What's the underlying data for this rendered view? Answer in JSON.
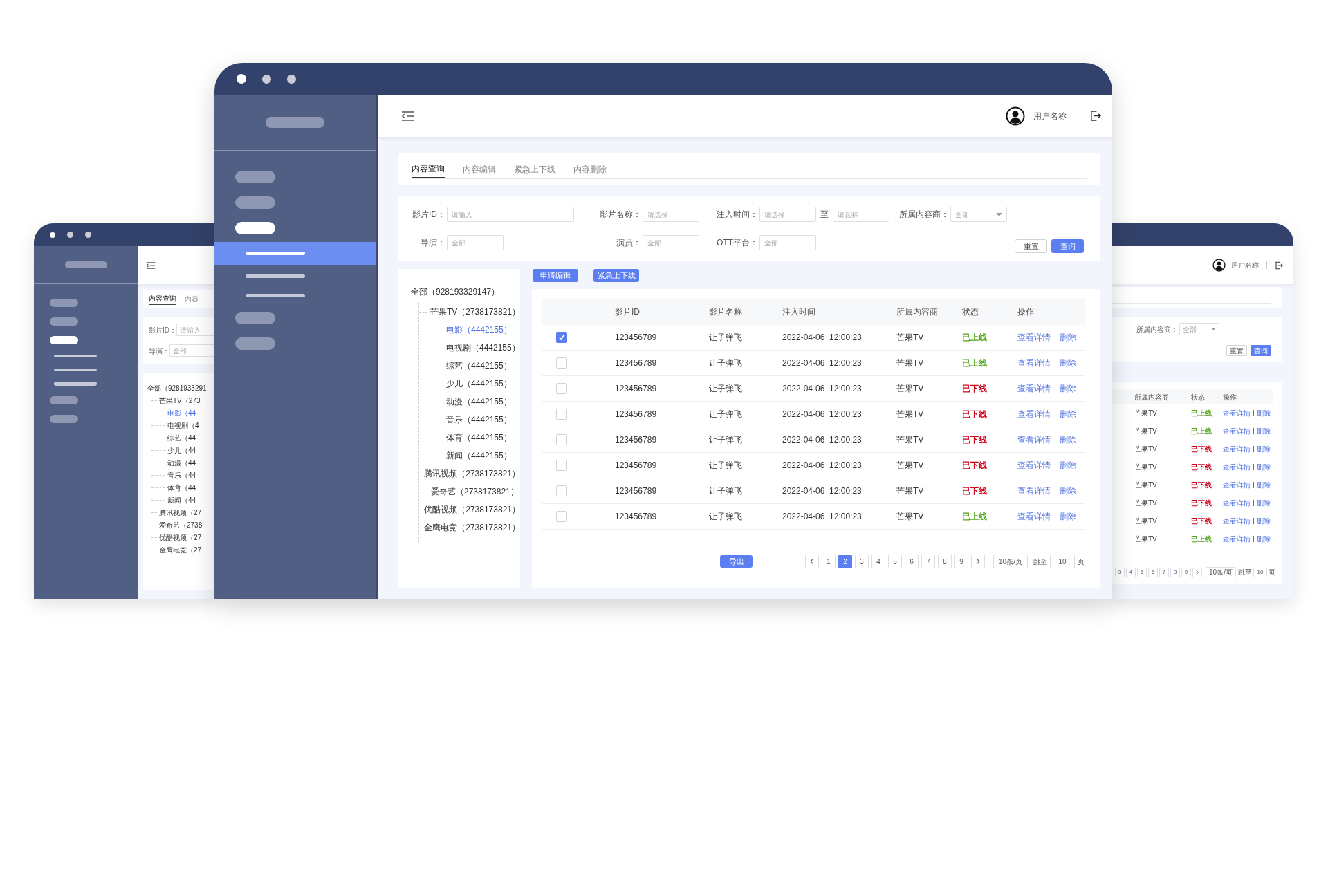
{
  "main_window": {
    "sidebar": {
      "items": [
        {
          "selected": false
        },
        {
          "selected": false
        },
        {
          "selected": true,
          "children": [
            {
              "selected": true
            },
            {
              "selected": false
            },
            {
              "selected": false
            }
          ]
        },
        {
          "selected": false
        },
        {
          "selected": false
        }
      ]
    },
    "user_name": "用户名称",
    "tabs": [
      {
        "label": "内容查询",
        "selected": true
      },
      {
        "label": "内容编辑",
        "selected": false
      },
      {
        "label": "紧急上下线",
        "selected": false
      },
      {
        "label": "内容删除",
        "selected": false
      }
    ],
    "filter_rows": [
      [
        {
          "kind": "input",
          "label": "影片ID：",
          "placeholder": "请输入"
        },
        {
          "kind": "input",
          "label": "影片名称：",
          "placeholder": "请选择"
        },
        {
          "kind": "range",
          "label": "注入时间：",
          "placeholder": "请选择",
          "separator": "至",
          "end_placeholder": "请选择"
        },
        {
          "kind": "select",
          "label": "所属内容商：",
          "placeholder": "全部"
        }
      ],
      [
        {
          "kind": "input",
          "label": "导演：",
          "placeholder": "全部"
        },
        {
          "kind": "input",
          "label": "演员：",
          "placeholder": "全部"
        },
        {
          "kind": "input",
          "label": "OTT平台：",
          "placeholder": "全部"
        }
      ]
    ],
    "filter_buttons": [
      {
        "label": "重置",
        "kind": "default"
      },
      {
        "label": "查询",
        "kind": "primary"
      }
    ],
    "tree": {
      "label": "全部（928193329147）",
      "selected": false,
      "children": [
        {
          "label": "芒果TV（2738173821）",
          "selected": false,
          "children": [
            {
              "label": "电影（4442155）",
              "selected": true
            },
            {
              "label": "电视剧（4442155）",
              "selected": false
            },
            {
              "label": "综艺（4442155）",
              "selected": false
            },
            {
              "label": "少儿（4442155）",
              "selected": false
            },
            {
              "label": "动漫（4442155）",
              "selected": false
            },
            {
              "label": "音乐（4442155）",
              "selected": false
            },
            {
              "label": "体育（4442155）",
              "selected": false
            },
            {
              "label": "新闻（4442155）",
              "selected": false
            }
          ]
        },
        {
          "label": "腾讯视频（2738173821）",
          "selected": false
        },
        {
          "label": "爱奇艺（2738173821）",
          "selected": false
        },
        {
          "label": "优酷视频（2738173821）",
          "selected": false
        },
        {
          "label": "金鹰电竞（2738173821）",
          "selected": false
        }
      ]
    },
    "toolbar_buttons": [
      "申请编辑",
      "紧急上下线"
    ],
    "table": {
      "columns": [
        "影片ID",
        "影片名称",
        "注入时间",
        "所属内容商",
        "状态",
        "操作"
      ],
      "rows": [
        {
          "checked": true,
          "id": "123456789",
          "name": "让子弹飞",
          "time": "2022-04-06  12:00:23",
          "provider": "芒果TV",
          "status": "已上线",
          "color": "#52a71a",
          "actions": [
            "查看详情",
            "删除"
          ]
        },
        {
          "checked": false,
          "id": "123456789",
          "name": "让子弹飞",
          "time": "2022-04-06  12:00:23",
          "provider": "芒果TV",
          "status": "已上线",
          "color": "#52a71a",
          "actions": [
            "查看详情",
            "删除"
          ]
        },
        {
          "checked": false,
          "id": "123456789",
          "name": "让子弹飞",
          "time": "2022-04-06  12:00:23",
          "provider": "芒果TV",
          "status": "已下线",
          "color": "#d0021b",
          "actions": [
            "查看详情",
            "删除"
          ]
        },
        {
          "checked": false,
          "id": "123456789",
          "name": "让子弹飞",
          "time": "2022-04-06  12:00:23",
          "provider": "芒果TV",
          "status": "已下线",
          "color": "#d0021b",
          "actions": [
            "查看详情",
            "删除"
          ]
        },
        {
          "checked": false,
          "id": "123456789",
          "name": "让子弹飞",
          "time": "2022-04-06  12:00:23",
          "provider": "芒果TV",
          "status": "已下线",
          "color": "#d0021b",
          "actions": [
            "查看详情",
            "删除"
          ]
        },
        {
          "checked": false,
          "id": "123456789",
          "name": "让子弹飞",
          "time": "2022-04-06  12:00:23",
          "provider": "芒果TV",
          "status": "已下线",
          "color": "#d0021b",
          "actions": [
            "查看详情",
            "删除"
          ]
        },
        {
          "checked": false,
          "id": "123456789",
          "name": "让子弹飞",
          "time": "2022-04-06  12:00:23",
          "provider": "芒果TV",
          "status": "已下线",
          "color": "#d0021b",
          "actions": [
            "查看详情",
            "删除"
          ]
        },
        {
          "checked": false,
          "id": "123456789",
          "name": "让子弹飞",
          "time": "2022-04-06  12:00:23",
          "provider": "芒果TV",
          "status": "已上线",
          "color": "#52a71a",
          "actions": [
            "查看详情",
            "删除"
          ]
        }
      ]
    },
    "export_button": "导出",
    "pagination": {
      "pages": [
        {
          "label": "1",
          "selected": false
        },
        {
          "label": "2",
          "selected": true
        },
        {
          "label": "3",
          "selected": false
        },
        {
          "label": "4",
          "selected": false
        },
        {
          "label": "5",
          "selected": false
        },
        {
          "label": "6",
          "selected": false
        },
        {
          "label": "7",
          "selected": false
        },
        {
          "label": "8",
          "selected": false
        },
        {
          "label": "9",
          "selected": false
        }
      ],
      "page_size": "10条/页",
      "jump_label": "跳至",
      "jump_value": "10",
      "page_unit": "页"
    }
  },
  "left_window": {
    "sidebar": {
      "items": [
        {
          "selected": false
        },
        {
          "selected": false
        },
        {
          "selected": true,
          "children": [
            {
              "selected": false
            },
            {
              "selected": false
            },
            {
              "selected": true
            }
          ]
        },
        {
          "selected": false
        },
        {
          "selected": false
        }
      ]
    },
    "tabs": [
      {
        "label": "内容查询",
        "selected": true
      },
      {
        "label": "内容",
        "selected": false
      }
    ],
    "filter_rows": [
      [
        {
          "kind": "input",
          "label": "影片ID：",
          "placeholder": "请输入"
        }
      ],
      [
        {
          "kind": "input",
          "label": "导演：",
          "placeholder": "全部"
        }
      ]
    ],
    "tree": {
      "label": "全部（9281933291",
      "selected": false,
      "children": [
        {
          "label": "芒果TV（273",
          "selected": false,
          "children": [
            {
              "label": "电影（44",
              "selected": true
            },
            {
              "label": "电视剧（4",
              "selected": false
            },
            {
              "label": "综艺（44",
              "selected": false
            },
            {
              "label": "少儿（44",
              "selected": false
            },
            {
              "label": "动漫（44",
              "selected": false
            },
            {
              "label": "音乐（44",
              "selected": false
            },
            {
              "label": "体育（44",
              "selected": false
            },
            {
              "label": "新闻（44",
              "selected": false
            }
          ]
        },
        {
          "label": "腾讯视频（27",
          "selected": false
        },
        {
          "label": "爱奇艺（2738",
          "selected": false
        },
        {
          "label": "优酷视频（27",
          "selected": false
        },
        {
          "label": "金鹰电竞（27",
          "selected": false
        }
      ]
    }
  },
  "right_window": {
    "user_name": "用户名称",
    "filter": {
      "label": "所属内容商：",
      "placeholder": "全部"
    },
    "filter_buttons": [
      {
        "label": "重置",
        "kind": "default"
      },
      {
        "label": "查询",
        "kind": "primary"
      }
    ],
    "table": {
      "columns": [
        "所属内容商",
        "状态",
        "操作"
      ],
      "rows": [
        {
          "provider": "芒果TV",
          "status": "已上线",
          "color": "#52a71a",
          "actions": [
            "查看详情",
            "删除"
          ]
        },
        {
          "provider": "芒果TV",
          "status": "已上线",
          "color": "#52a71a",
          "actions": [
            "查看详情",
            "删除"
          ]
        },
        {
          "provider": "芒果TV",
          "status": "已下线",
          "color": "#d0021b",
          "actions": [
            "查看详情",
            "删除"
          ]
        },
        {
          "provider": "芒果TV",
          "status": "已下线",
          "color": "#d0021b",
          "actions": [
            "查看详情",
            "删除"
          ]
        },
        {
          "provider": "芒果TV",
          "status": "已下线",
          "color": "#d0021b",
          "actions": [
            "查看详情",
            "删除"
          ]
        },
        {
          "provider": "芒果TV",
          "status": "已下线",
          "color": "#d0021b",
          "actions": [
            "查看详情",
            "删除"
          ]
        },
        {
          "provider": "芒果TV",
          "status": "已下线",
          "color": "#d0021b",
          "actions": [
            "查看详情",
            "删除"
          ]
        },
        {
          "provider": "芒果TV",
          "status": "已上线",
          "color": "#52a71a",
          "actions": [
            "查看详情",
            "删除"
          ]
        }
      ]
    },
    "pagination": {
      "pages": [
        {
          "label": "3",
          "selected": false
        },
        {
          "label": "4",
          "selected": false
        },
        {
          "label": "5",
          "selected": false
        },
        {
          "label": "6",
          "selected": false
        },
        {
          "label": "7",
          "selected": false
        },
        {
          "label": "8",
          "selected": false
        },
        {
          "label": "9",
          "selected": false
        }
      ],
      "page_size": "10条/页",
      "jump_label": "跳至",
      "jump_value": "10",
      "page_unit": "页"
    }
  }
}
